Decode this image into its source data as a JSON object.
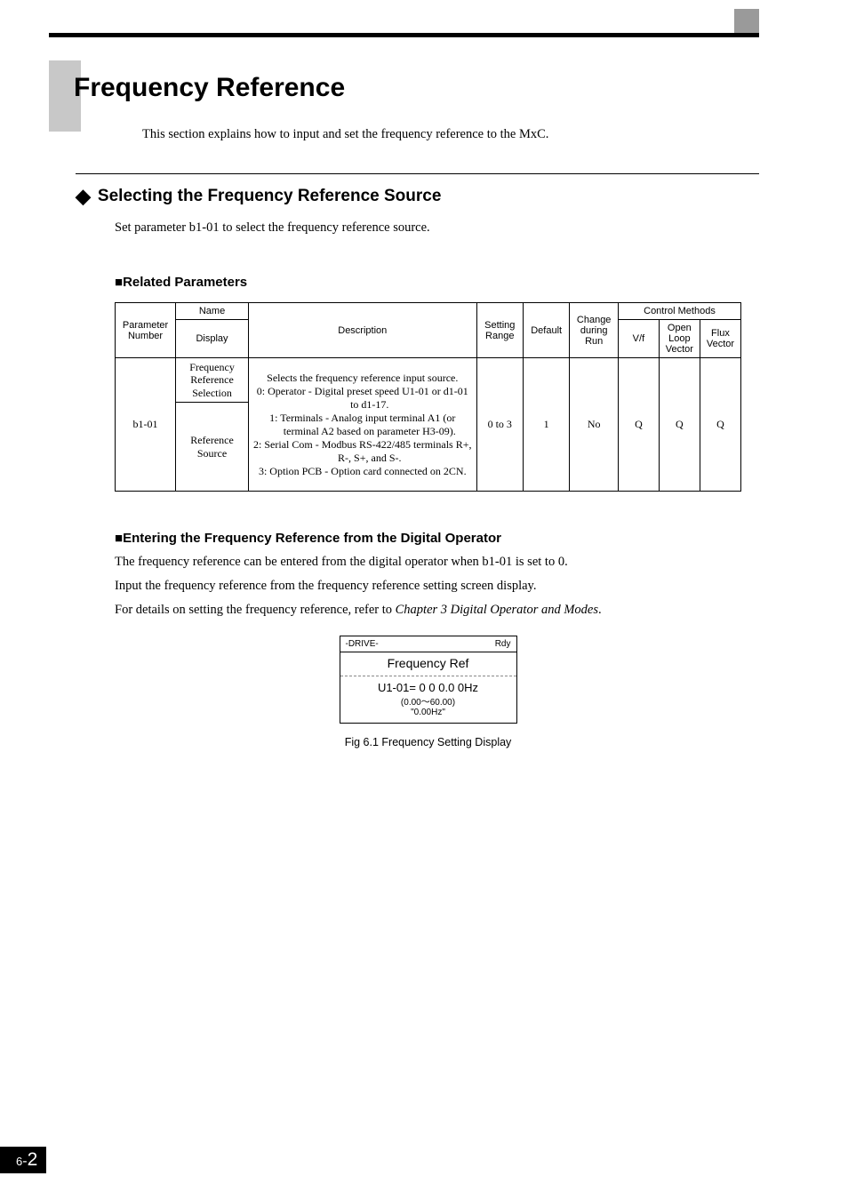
{
  "page": {
    "title": "Frequency Reference",
    "intro": "This section explains how to input and set the frequency reference to the MxC.",
    "chapter": "6",
    "pagenum": "2"
  },
  "section": {
    "heading": "Selecting the Frequency Reference Source",
    "set_param": "Set parameter b1-01 to select the frequency reference source."
  },
  "related": {
    "heading": "Related Parameters",
    "table": {
      "headers": {
        "param_no": "Parameter Number",
        "name": "Name",
        "display": "Display",
        "description": "Description",
        "setting_range": "Setting Range",
        "default": "Default",
        "change_run": "Change during Run",
        "control_methods": "Control Methods",
        "vf": "V/f",
        "olv": "Open Loop Vector",
        "flux": "Flux Vector"
      },
      "row": {
        "param_no": "b1-01",
        "name1": "Frequency Reference Selection",
        "name2": "Reference Source",
        "desc_intro": "Selects the frequency reference input source.",
        "desc0": "0: Operator - Digital preset speed U1-01 or d1-01 to d1-17.",
        "desc1": "1: Terminals - Analog input terminal A1 (or terminal A2 based on parameter H3-09).",
        "desc2": "2: Serial Com - Modbus RS-422/485 terminals R+, R-, S+, and S-.",
        "desc3": "3: Option PCB - Option card connected on 2CN.",
        "setting_range": "0 to 3",
        "default": "1",
        "change_run": "No",
        "vf": "Q",
        "olv": "Q",
        "flux": "Q"
      }
    }
  },
  "entering": {
    "heading": "Entering the Frequency Reference from the Digital Operator",
    "p1": "The frequency reference can be entered from the digital operator when b1-01 is set to 0.",
    "p2": "Input the frequency reference from the frequency reference setting screen display.",
    "p3a": "For details on setting the frequency reference, refer to ",
    "p3b": "Chapter 3 Digital Operator and Modes",
    "p3c": "."
  },
  "operator_display": {
    "mode": "-DRIVE-",
    "status": "Rdy",
    "title": "Frequency Ref",
    "line1": "U1-01= 0 0 0.0 0Hz",
    "line2": "(0.00～60.00)",
    "line3": "\"0.00Hz\"",
    "caption": "Fig 6.1   Frequency Setting Display"
  }
}
